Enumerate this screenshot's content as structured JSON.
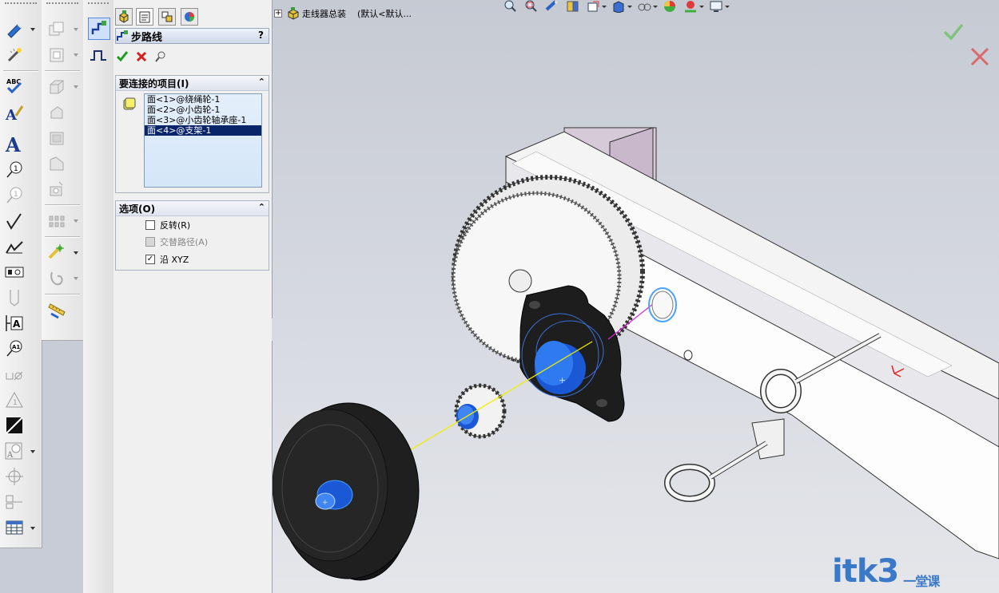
{
  "left_toolbar": {
    "icons": [
      "smart-dimension-icon",
      "model-items-icon",
      "spell-check-icon",
      "format-painter-icon",
      "note-icon",
      "balloon-icon",
      "auto-balloon-icon",
      "surface-finish-icon",
      "weld-symbol-icon",
      "hole-callout-icon",
      "geometric-tolerance-icon",
      "datum-feature-icon",
      "datum-target-icon",
      "blocks-icon",
      "area-hatch-icon",
      "revision-symbol-icon",
      "center-mark-icon",
      "centerline-icon",
      "table-icon"
    ]
  },
  "property_manager": {
    "title": "步路线",
    "help": "?",
    "group_items": {
      "header": "要连接的项目(I)",
      "items": [
        "面<1>@绕绳轮-1",
        "面<2>@小齿轮-1",
        "面<3>@小齿轮轴承座-1",
        "面<4>@支架-1"
      ],
      "selected_index": 3
    },
    "group_options": {
      "header": "选项(O)",
      "options": [
        {
          "label": "反转(R)",
          "checked": false,
          "disabled": false
        },
        {
          "label": "交替路径(A)",
          "checked": false,
          "disabled": true
        },
        {
          "label": "沿 XYZ",
          "checked": true,
          "disabled": false
        }
      ]
    }
  },
  "feature_tree": {
    "expander": "+",
    "assembly": "走线器总装",
    "config": "(默认<默认...",
    "icon": "assembly-icon"
  },
  "watermark": {
    "brand": "itk3",
    "suffix": "一堂课"
  },
  "colors": {
    "accept": "#7fc57f",
    "reject": "#d96a6a",
    "selection_bg": "#0a246a",
    "route_line_yellow": "#f0f000",
    "route_line_magenta": "#e020e0",
    "watermark": "#3a78c8"
  }
}
